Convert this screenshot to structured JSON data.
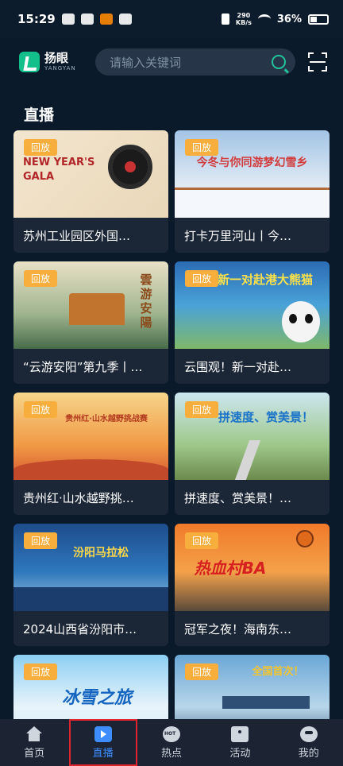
{
  "status_bar": {
    "time": "15:29",
    "speed_value": "290",
    "speed_unit": "KB/s",
    "battery": "36%"
  },
  "header": {
    "logo_cn": "扬眼",
    "logo_en": "YANGYAN",
    "search_placeholder": "请输入关键词"
  },
  "section": {
    "title": "直播"
  },
  "cards": [
    {
      "badge": "回放",
      "title": "苏州工业园区外国…",
      "thumb_text": "NEW YEAR'S GALA"
    },
    {
      "badge": "回放",
      "title": "打卡万里河山丨今…",
      "thumb_text": "今冬与你同游梦幻雪乡"
    },
    {
      "badge": "回放",
      "title": "“云游安阳”第九季丨…",
      "thumb_text": "雲游安陽"
    },
    {
      "badge": "回放",
      "title": "云围观！新一对赴…",
      "thumb_text": "新一对赴港大熊猫"
    },
    {
      "badge": "回放",
      "title": "贵州红·山水越野挑…",
      "thumb_text": "贵州红·山水越野挑战赛"
    },
    {
      "badge": "回放",
      "title": "拼速度、赏美景！…",
      "thumb_text": "拼速度、赏美景！"
    },
    {
      "badge": "回放",
      "title": "2024山西省汾阳市…",
      "thumb_text": "汾阳马拉松"
    },
    {
      "badge": "回放",
      "title": "冠军之夜！海南东…",
      "thumb_text": "热血村BA"
    },
    {
      "badge": "回放",
      "title": "",
      "thumb_text": "冰雪之旅"
    },
    {
      "badge": "回放",
      "title": "",
      "thumb_text": "全国首次！"
    }
  ],
  "tabs": [
    {
      "label": "首页",
      "icon": "home-icon"
    },
    {
      "label": "直播",
      "icon": "live-icon"
    },
    {
      "label": "热点",
      "icon": "hot-icon"
    },
    {
      "label": "活动",
      "icon": "activity-icon"
    },
    {
      "label": "我的",
      "icon": "me-icon"
    }
  ],
  "colors": {
    "background": "#0b1a2b",
    "accent": "#3d8dff",
    "badge": "#f7ae3c",
    "search_icon": "#21c39a"
  }
}
